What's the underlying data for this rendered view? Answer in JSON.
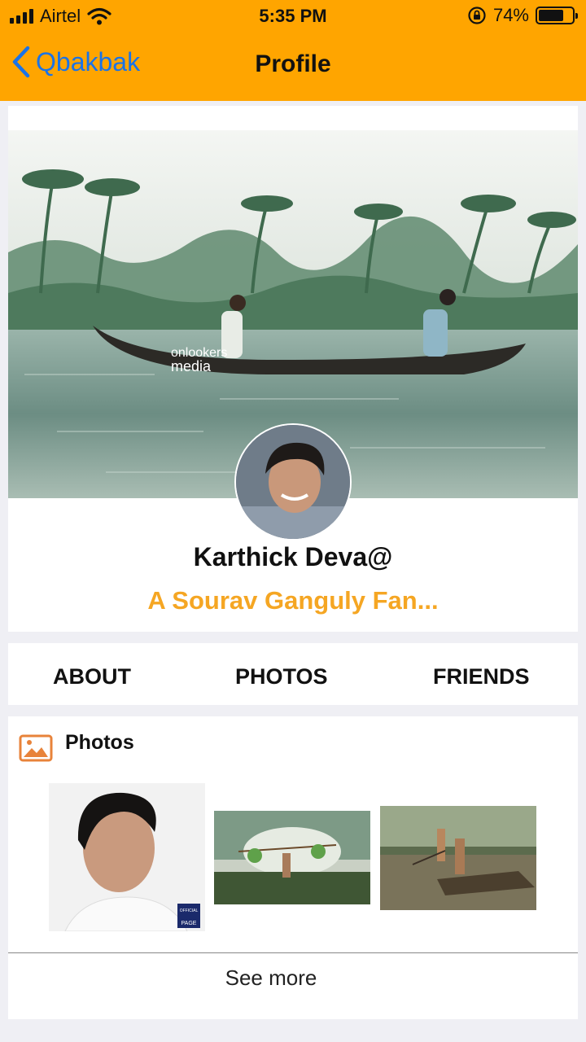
{
  "status_bar": {
    "carrier": "Airtel",
    "time": "5:35 PM",
    "battery_pct": "74%",
    "battery_level": 0.74
  },
  "nav": {
    "back_label": "Qbakbak",
    "title": "Profile"
  },
  "profile": {
    "name": "Karthick  Deva@",
    "tagline": "A  Sourav Ganguly Fan...",
    "cover_watermark_line1": "onlookers",
    "cover_watermark_line2": "media"
  },
  "tabs": [
    {
      "label": "ABOUT"
    },
    {
      "label": "PHOTOS"
    },
    {
      "label": "FRIENDS"
    }
  ],
  "photos": {
    "title": "Photos",
    "see_more": "See more",
    "thumb1_badge_line1": "OFFICIAL",
    "thumb1_badge_line2": "PAGE"
  },
  "colors": {
    "header_bg": "#FFA500",
    "back_link": "#1a73e8",
    "tagline": "#F5A623",
    "photos_icon": "#E8833A"
  },
  "icons": [
    "signal-icon",
    "wifi-icon",
    "rotation-lock-icon",
    "battery-icon",
    "back-chevron-icon",
    "photos-icon"
  ]
}
